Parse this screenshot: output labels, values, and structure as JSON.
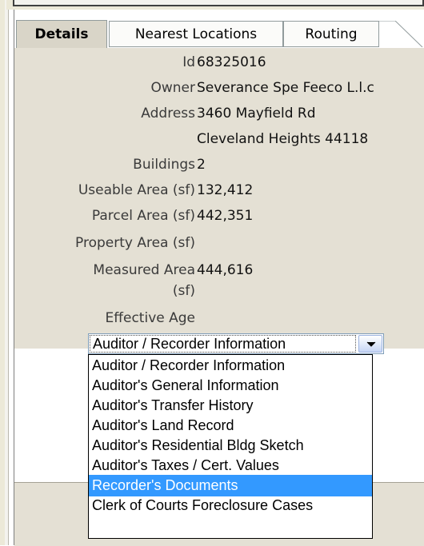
{
  "tabs": [
    {
      "label": "Details"
    },
    {
      "label": "Nearest Locations"
    },
    {
      "label": "Routing"
    }
  ],
  "details": {
    "rows": [
      {
        "label": "Id",
        "value": "68325016"
      },
      {
        "label": "Owner",
        "value": "Severance Spe Feeco L.l.c"
      },
      {
        "label": "Address",
        "value": "3460 Mayfield Rd"
      },
      {
        "label": "",
        "value": "Cleveland Heights 44118"
      },
      {
        "label": "Buildings",
        "value": "2"
      },
      {
        "label": "Useable Area (sf)",
        "value": "132,412"
      },
      {
        "label": "Parcel Area (sf)",
        "value": "442,351"
      },
      {
        "label": "Property Area (sf)",
        "value": ""
      },
      {
        "label": "Measured Area",
        "value": "444,616"
      },
      {
        "label": "(sf)",
        "value": ""
      },
      {
        "label": "Effective Age",
        "value": ""
      }
    ]
  },
  "report_select": {
    "selected": "Auditor / Recorder Information",
    "options": [
      "Auditor / Recorder Information",
      "Auditor's General Information",
      "Auditor's Transfer History",
      "Auditor's Land Record",
      "Auditor's Residential Bldg Sketch",
      "Auditor's Taxes / Cert. Values",
      "Recorder's Documents",
      "Clerk of Courts Foreclosure Cases"
    ],
    "highlighted": "Recorder's Documents"
  },
  "colors": {
    "panel_bg": "#e4e0d4",
    "highlight": "#3399ff"
  }
}
